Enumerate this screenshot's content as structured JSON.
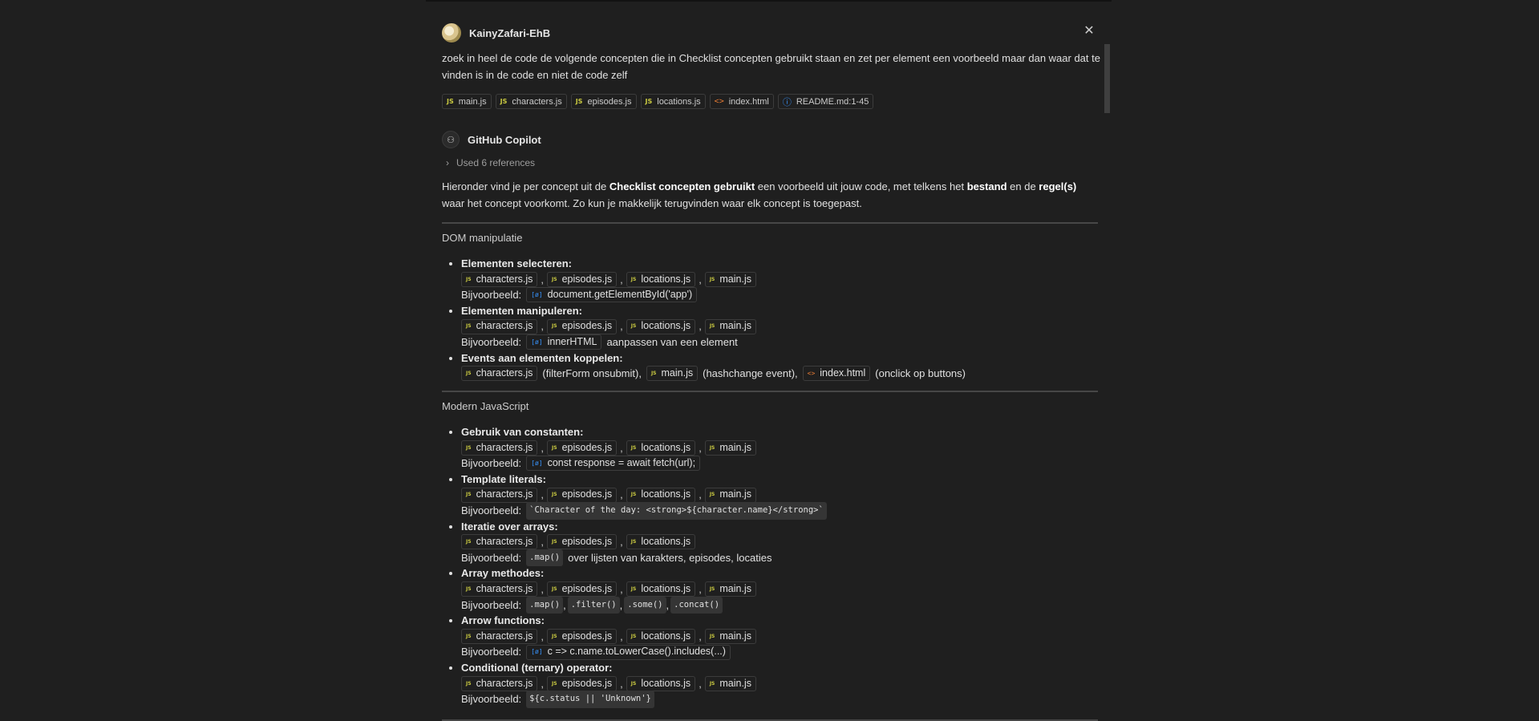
{
  "user": {
    "name": "KainyZafari-EhB"
  },
  "prompt": "zoek in heel de code de volgende concepten die in Checklist concepten gebruikt staan en zet per element een voorbeeld maar dan waar dat te vinden is in de code en niet de code zelf",
  "attachments": [
    {
      "icon": "js",
      "label": "main.js"
    },
    {
      "icon": "js",
      "label": "characters.js"
    },
    {
      "icon": "js",
      "label": "episodes.js"
    },
    {
      "icon": "js",
      "label": "locations.js"
    },
    {
      "icon": "html",
      "label": "index.html"
    },
    {
      "icon": "info",
      "label": "README.md:1-45"
    }
  ],
  "assistant": {
    "name": "GitHub Copilot",
    "references_label": "Used 6 references"
  },
  "intro": {
    "p1": "Hieronder vind je per concept uit de ",
    "b1": "Checklist concepten gebruikt",
    "p2": " een voorbeeld uit jouw code, met telkens het ",
    "b2": "bestand",
    "p3": " en de ",
    "b3": "regel(s)",
    "p4": " waar het concept voorkomt. Zo kun je makkelijk terugvinden waar elk concept is toegepast."
  },
  "sections": [
    {
      "title": "DOM manipulatie",
      "items": [
        {
          "title": "Elementen selecteren:",
          "files": [
            "characters.js",
            "episodes.js",
            "locations.js",
            "main.js"
          ],
          "example_label": "Bijvoorbeeld:",
          "example_symbol": "document.getElementById('app')"
        },
        {
          "title": "Elementen manipuleren:",
          "files": [
            "characters.js",
            "episodes.js",
            "locations.js",
            "main.js"
          ],
          "example_label": "Bijvoorbeeld:",
          "example_symbol": "innerHTML",
          "example_after": "aanpassen van een element"
        },
        {
          "title": "Events aan elementen koppelen:",
          "events": [
            {
              "file": "characters.js",
              "icon": "js",
              "note": "(filterForm onsubmit),"
            },
            {
              "file": "main.js",
              "icon": "js",
              "note": "(hashchange event),"
            },
            {
              "file": "index.html",
              "icon": "html",
              "note": "(onclick op buttons)"
            }
          ]
        }
      ]
    },
    {
      "title": "Modern JavaScript",
      "items": [
        {
          "title": "Gebruik van constanten:",
          "files": [
            "characters.js",
            "episodes.js",
            "locations.js",
            "main.js"
          ],
          "example_label": "Bijvoorbeeld:",
          "example_symbol": "const response = await fetch(url);"
        },
        {
          "title": "Template literals:",
          "files": [
            "characters.js",
            "episodes.js",
            "locations.js",
            "main.js"
          ],
          "example_label": "Bijvoorbeeld:",
          "example_code": [
            "`Character of the day: <strong>${character.name}</strong>`"
          ]
        },
        {
          "title": "Iteratie over arrays:",
          "files": [
            "characters.js",
            "episodes.js",
            "locations.js"
          ],
          "example_label": "Bijvoorbeeld:",
          "example_code": [
            ".map()"
          ],
          "example_after": "over lijsten van karakters, episodes, locaties"
        },
        {
          "title": "Array methodes:",
          "files": [
            "characters.js",
            "episodes.js",
            "locations.js",
            "main.js"
          ],
          "example_label": "Bijvoorbeeld:",
          "example_code": [
            ".map()",
            ".filter()",
            ".some()",
            ".concat()"
          ]
        },
        {
          "title": "Arrow functions:",
          "files": [
            "characters.js",
            "episodes.js",
            "locations.js",
            "main.js"
          ],
          "example_label": "Bijvoorbeeld:",
          "example_symbol": "c => c.name.toLowerCase().includes(...)"
        },
        {
          "title": "Conditional (ternary) operator:",
          "files": [
            "characters.js",
            "episodes.js",
            "locations.js",
            "main.js"
          ],
          "example_label": "Bijvoorbeeld:",
          "example_code": [
            "${c.status || 'Unknown'}"
          ]
        }
      ]
    }
  ],
  "icons": {
    "close": "close-icon",
    "js": "js-icon",
    "html": "html-icon",
    "info": "info-icon",
    "symbol": "symbol-icon",
    "chevron": "chevron-right-icon",
    "copilot": "copilot-icon"
  },
  "colors": {
    "background": "#1f1f1f",
    "js_icon": "#cbcb41",
    "html_icon": "#e37933",
    "info_icon": "#3794ff",
    "symbol_icon": "#3794ff"
  }
}
